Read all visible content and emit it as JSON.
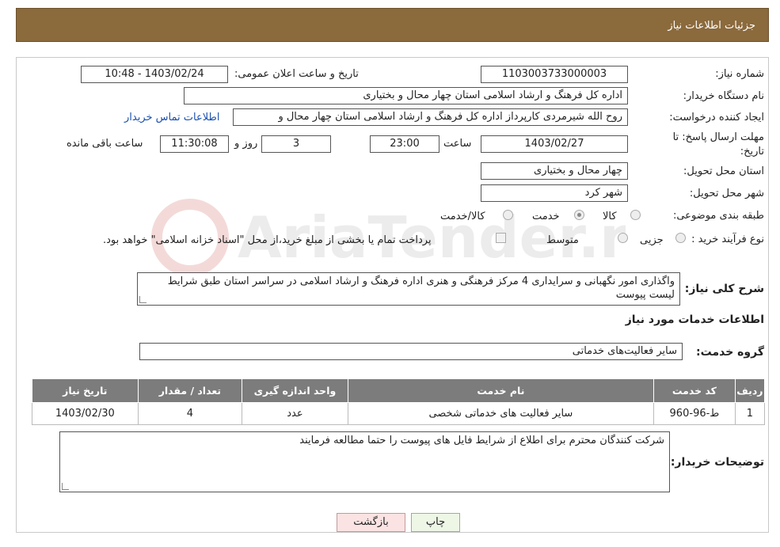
{
  "header": {
    "title": "جزئیات اطلاعات نیاز"
  },
  "fields": {
    "need_number_label": "شماره نیاز:",
    "need_number": "1103003733000003",
    "announce_datetime_label": "تاریخ و ساعت اعلان عمومی:",
    "announce_datetime": "1403/02/24 - 10:48",
    "buyer_org_label": "نام دستگاه خریدار:",
    "buyer_org": "اداره کل فرهنگ و ارشاد اسلامی استان چهار محال و بختیاری",
    "requester_label": "ایجاد کننده درخواست:",
    "requester": "روح الله شیرمردی کارپرداز اداره کل فرهنگ و ارشاد اسلامی استان چهار محال و",
    "buyer_contact_link": "اطلاعات تماس خریدار",
    "deadline_label": "مهلت ارسال پاسخ: تا تاریخ:",
    "deadline_date": "1403/02/27",
    "time_label": "ساعت",
    "deadline_time": "23:00",
    "days_value": "3",
    "days_label": "روز و",
    "remaining_time": "11:30:08",
    "remaining_label": "ساعت باقی مانده",
    "delivery_province_label": "استان محل تحویل:",
    "delivery_province": "چهار محال و بختیاری",
    "delivery_city_label": "شهر محل تحویل:",
    "delivery_city": "شهر کرد",
    "category_label": "طبقه بندی موضوعی:",
    "category_options": [
      {
        "label": "کالا",
        "checked": false
      },
      {
        "label": "خدمت",
        "checked": true
      },
      {
        "label": "کالا/خدمت",
        "checked": false
      }
    ],
    "purchase_type_label": "نوع فرآیند خرید :",
    "purchase_type_options": [
      {
        "label": "جزیی",
        "checked": false
      },
      {
        "label": "متوسط",
        "checked": false
      }
    ],
    "payment_note": "پرداخت تمام یا بخشی از مبلغ خرید،از محل \"اسناد خزانه اسلامی\" خواهد بود.",
    "general_desc_label": "شرح کلی نیاز:",
    "general_desc": "واگذاری امور نگهبانی و سرایداری 4 مرکز فرهنگی و هنری اداره فرهنگ و ارشاد اسلامی در سراسر استان طبق شرایط لیست پیوست"
  },
  "services_section": {
    "title": "اطلاعات خدمات مورد نیاز",
    "service_group_label": "گروه خدمت:",
    "service_group": "سایر فعالیت‌های خدماتی"
  },
  "table": {
    "headers": [
      "ردیف",
      "کد خدمت",
      "نام خدمت",
      "واحد اندازه گیری",
      "تعداد / مقدار",
      "تاریخ نیاز"
    ],
    "rows": [
      [
        "1",
        "ط-96-960",
        "سایر فعالیت های خدماتی شخصی",
        "عدد",
        "4",
        "1403/02/30"
      ]
    ]
  },
  "buyer_notes": {
    "label": "توضیحات خریدار:",
    "text": "شرکت کنندگان محترم برای اطلاع از شرایط فایل های پیوست را حتما مطالعه فرمایند"
  },
  "buttons": {
    "print": "چاپ",
    "back": "بازگشت"
  },
  "watermark": {
    "text": "AriaTender.neT"
  }
}
